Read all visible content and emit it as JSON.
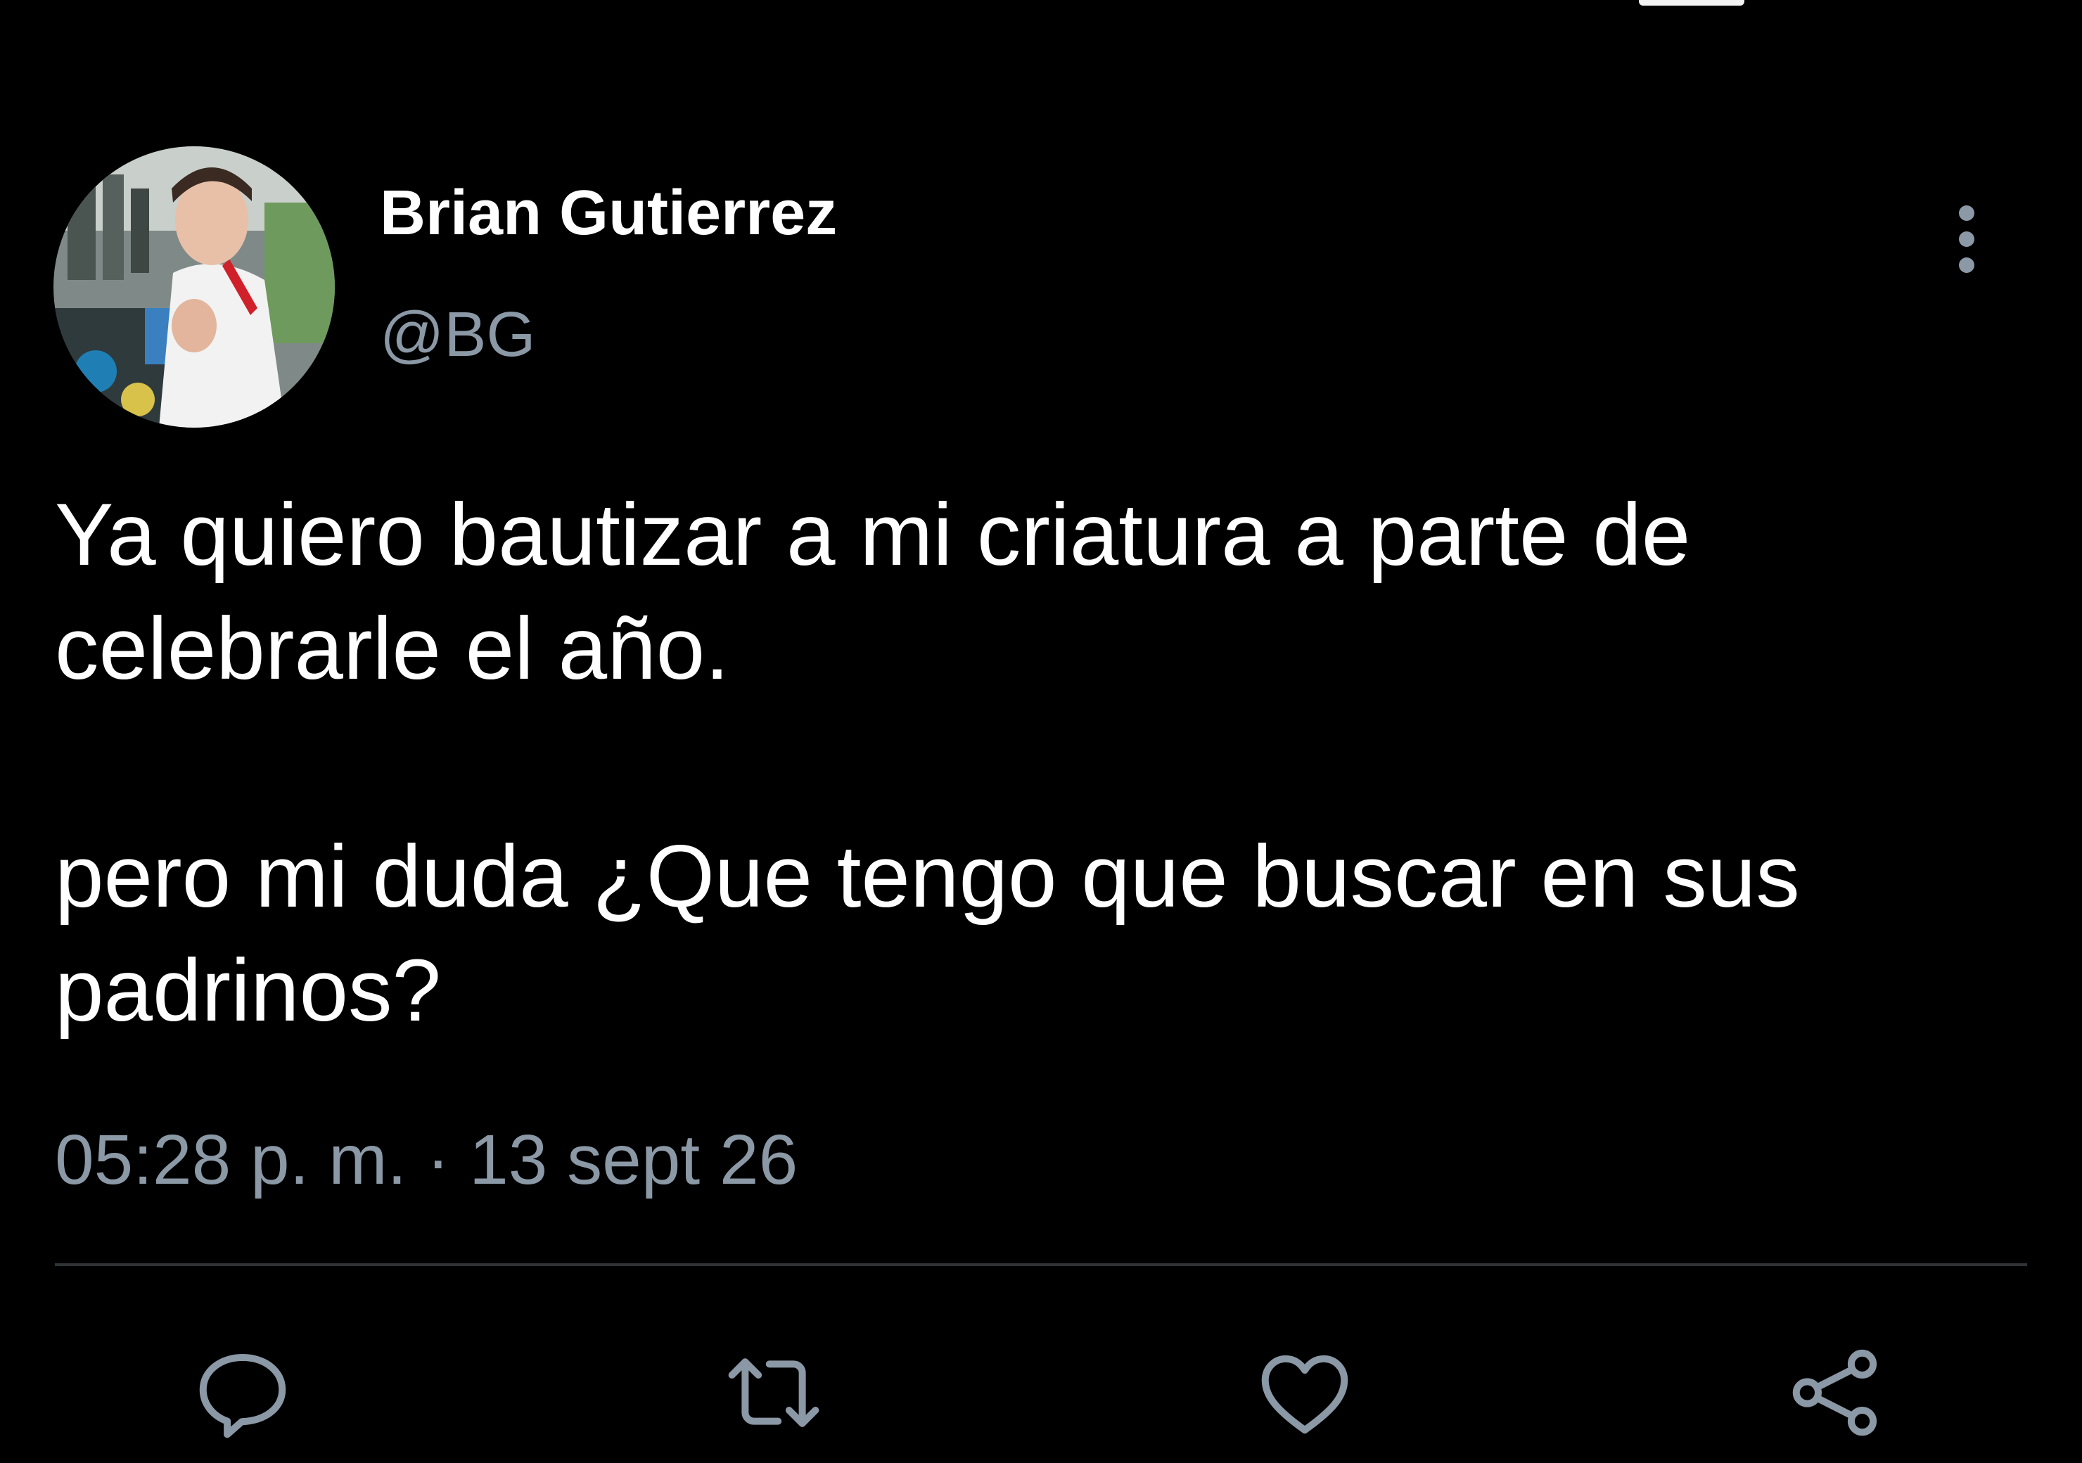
{
  "tweet": {
    "author": {
      "display_name": "Brian Gutierrez",
      "handle": "@BG"
    },
    "text_paragraphs": [
      "Ya quiero bautizar a mi criatura a parte de celebrarle el año.",
      "pero mi duda ¿Que tengo que buscar en sus padrinos?"
    ],
    "timestamp": "05:28 p. m. · 13 sept 26"
  },
  "icons": {
    "more": "more-vertical-icon",
    "reply": "reply-icon",
    "retweet": "retweet-icon",
    "like": "heart-icon",
    "share": "share-icon"
  },
  "colors": {
    "background": "#000000",
    "primary_text": "#ffffff",
    "secondary_text": "#8b98a5",
    "divider": "#2f3336"
  }
}
